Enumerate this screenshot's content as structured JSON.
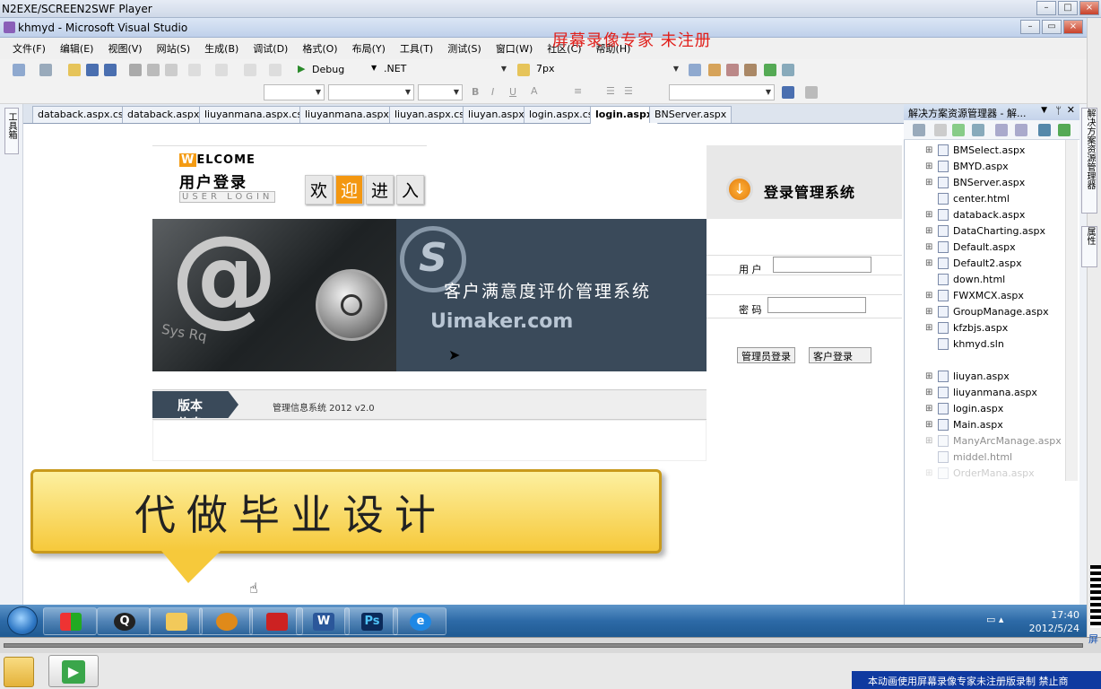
{
  "player": {
    "title": "N2EXE/SCREEN2SWF Player"
  },
  "vs": {
    "title": "khmyd - Microsoft Visual Studio"
  },
  "menu": [
    "文件(F)",
    "编辑(E)",
    "视图(V)",
    "网站(S)",
    "生成(B)",
    "调试(D)",
    "格式(O)",
    "布局(Y)",
    "工具(T)",
    "测试(S)",
    "窗口(W)",
    "社区(C)",
    "帮助(H)"
  ],
  "watermark_top": "屏幕录像专家 未注册",
  "toolbar": {
    "config": "Debug",
    "platform": ".NET",
    "font_size": "7px"
  },
  "left_strip": {
    "toolbox": "工具箱"
  },
  "doc_tabs": [
    "databack.aspx.cs",
    "databack.aspx",
    "liuyanmana.aspx.cs",
    "liuyanmana.aspx",
    "liuyan.aspx.cs",
    "liuyan.aspx",
    "login.aspx.cs",
    "login.aspx",
    "BNServer.aspx"
  ],
  "active_tab": "login.aspx",
  "solution": {
    "title": "解决方案资源管理器 - 解...",
    "items": [
      "BMSelect.aspx",
      "BMYD.aspx",
      "BNServer.aspx",
      "center.html",
      "databack.aspx",
      "DataCharting.aspx",
      "Default.aspx",
      "Default2.aspx",
      "down.html",
      "FWXMCX.aspx",
      "GroupManage.aspx",
      "kfzbjs.aspx",
      "khmyd.sln",
      "liuyan.aspx",
      "liuyanmana.aspx",
      "login.aspx",
      "Main.aspx",
      "ManyArcManage.aspx",
      "middel.html",
      "OrderMana.aspx"
    ]
  },
  "right_tabs": [
    "解决方案资源管理器",
    "属性"
  ],
  "login_page": {
    "welcome_w": "W",
    "welcome_rest": "ELCOME",
    "user_login": "用户登录",
    "user_login_en": "USER LOGIN",
    "huanying": [
      "欢",
      "迎",
      "进",
      "入"
    ],
    "system_title": "登录管理系统",
    "banner_name": "客户满意度评价管理系统",
    "uimaker": "Uimaker.com",
    "keys": "Sys Rq",
    "user_label": "用 户",
    "pwd_label": "密 码",
    "admin_btn": "管理员登录",
    "customer_btn": "客户登录",
    "version_tag": "版本信息",
    "version_text": "管理信息系统 2012 v2.0"
  },
  "bubble": "代做毕业设计",
  "taskbar": {
    "time": "17:40",
    "date": "2012/5/24"
  },
  "bottom_notice": "本动画使用屏幕录像专家未注册版录制 禁止商",
  "side_watermark": "屏",
  "colors": {
    "accent_orange": "#f49b13",
    "banner_dark": "#3a4a5a",
    "watermark_red": "#e0201c",
    "notice_blue": "#0f3aa0"
  }
}
